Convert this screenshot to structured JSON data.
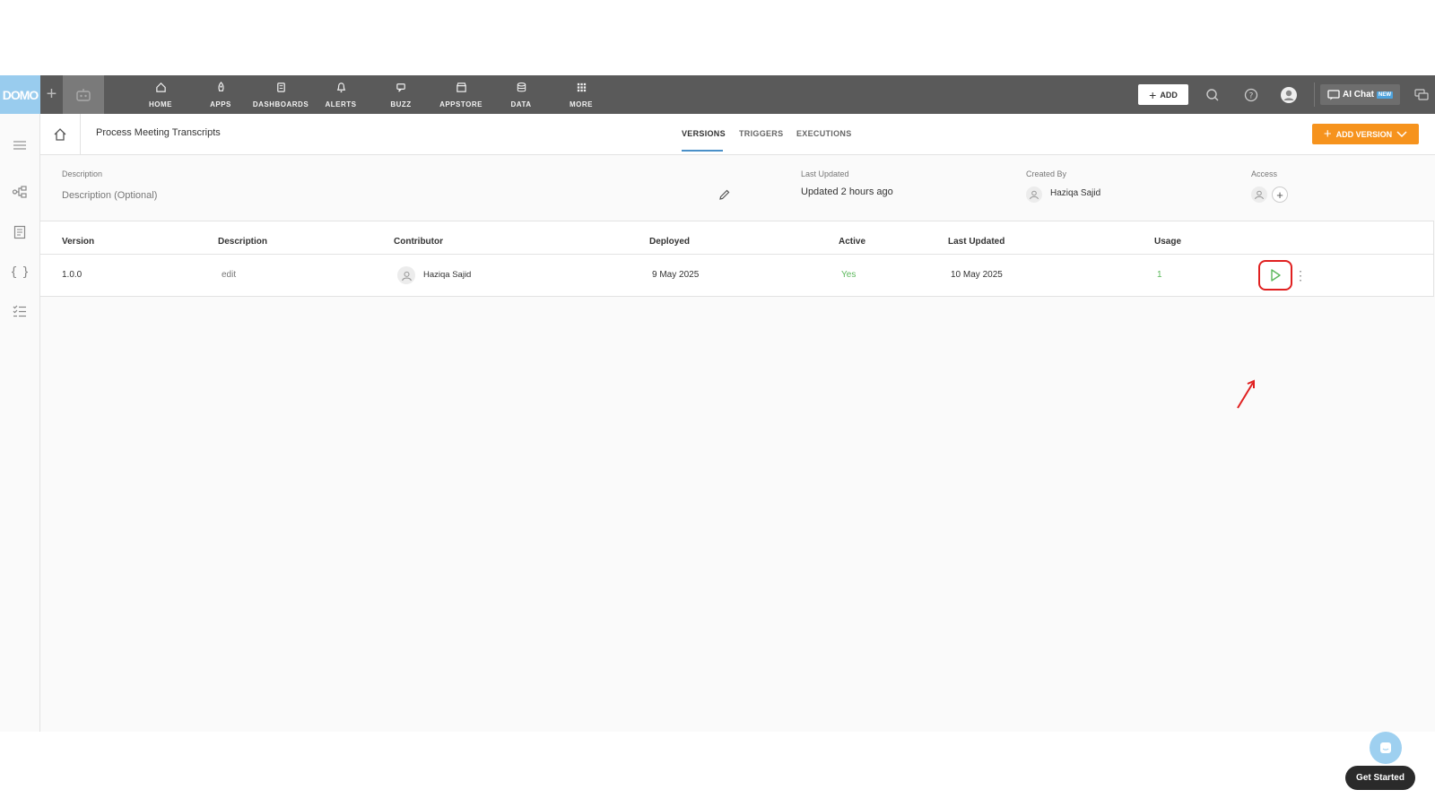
{
  "nav": {
    "logo": "DOMO",
    "items": [
      {
        "label": "HOME",
        "icon": "home-icon"
      },
      {
        "label": "APPS",
        "icon": "rocket-icon"
      },
      {
        "label": "DASHBOARDS",
        "icon": "dashboard-icon"
      },
      {
        "label": "ALERTS",
        "icon": "bell-icon"
      },
      {
        "label": "BUZZ",
        "icon": "chat-icon"
      },
      {
        "label": "APPSTORE",
        "icon": "store-icon"
      },
      {
        "label": "DATA",
        "icon": "database-icon"
      },
      {
        "label": "MORE",
        "icon": "grid-icon"
      }
    ],
    "add_label": "ADD",
    "ai_chat_label": "AI Chat",
    "ai_chat_badge": "NEW"
  },
  "header": {
    "title": "Process Meeting Transcripts",
    "tabs": [
      "VERSIONS",
      "TRIGGERS",
      "EXECUTIONS"
    ],
    "active_tab": "VERSIONS",
    "add_version_label": "ADD VERSION"
  },
  "meta": {
    "description_label": "Description",
    "description_value": "Description (Optional)",
    "last_updated_label": "Last Updated",
    "last_updated_value": "Updated 2 hours ago",
    "created_by_label": "Created By",
    "created_by_value": "Haziqa Sajid",
    "access_label": "Access"
  },
  "table": {
    "columns": [
      "Version",
      "Description",
      "Contributor",
      "Deployed",
      "Active",
      "Last Updated",
      "Usage"
    ],
    "rows": [
      {
        "version": "1.0.0",
        "description": "edit",
        "contributor": "Haziqa Sajid",
        "deployed": "9 May 2025",
        "active": "Yes",
        "last_updated": "10 May 2025",
        "usage": "1"
      }
    ]
  },
  "colors": {
    "accent_orange": "#f6931d",
    "active_green": "#5cb85c",
    "annotation_red": "#e02020"
  },
  "widget": {
    "get_started_label": "Get Started"
  }
}
